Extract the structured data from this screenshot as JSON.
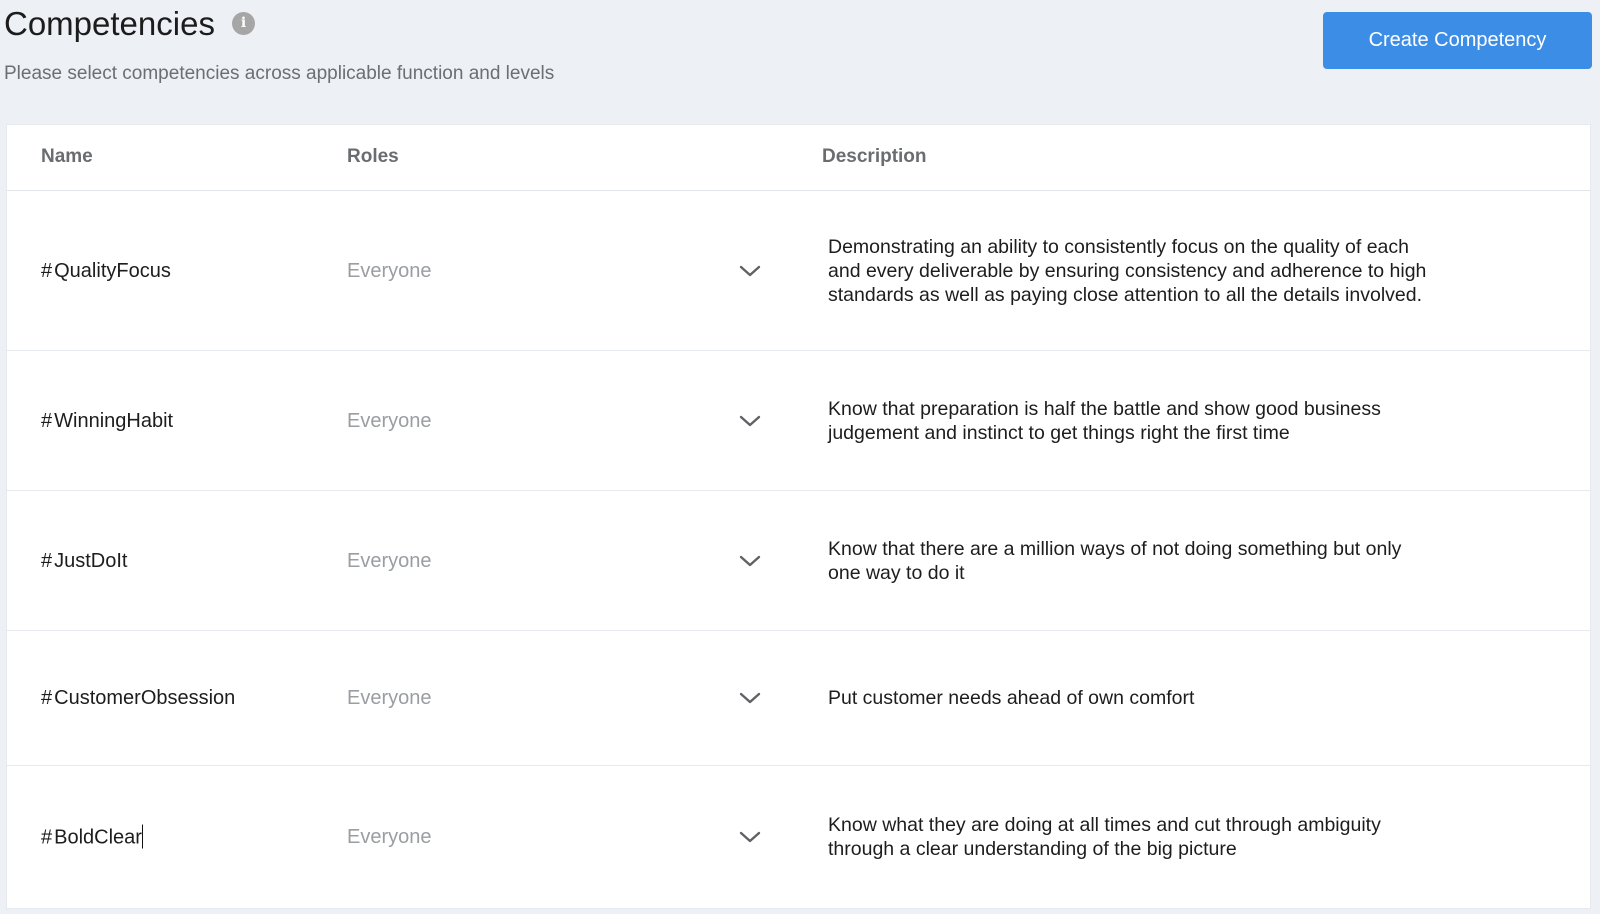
{
  "header": {
    "title": "Competencies",
    "info_icon": "info-icon",
    "subtitle": "Please select competencies across applicable function and levels",
    "create_button_label": "Create Competency",
    "accent_color": "#3b8de6"
  },
  "table": {
    "columns": {
      "name": "Name",
      "roles": "Roles",
      "description": "Description"
    },
    "rows": [
      {
        "hash": "#",
        "name": "QualityFocus",
        "roles": "Everyone",
        "description": "Demonstrating an ability to consistently focus on the quality of each and every deliverable by ensuring consistency and adherence to high standards as well as paying close attention to all the details involved."
      },
      {
        "hash": "#",
        "name": "WinningHabit",
        "roles": "Everyone",
        "description": "Know that preparation is half the battle and show good business judgement and instinct to get things right the first time"
      },
      {
        "hash": "#",
        "name": "JustDoIt",
        "roles": "Everyone",
        "description": "Know that there are a million ways of not doing something but only one way to do it"
      },
      {
        "hash": "#",
        "name": "CustomerObsession",
        "roles": "Everyone",
        "description": "Put customer needs ahead of own comfort"
      },
      {
        "hash": "#",
        "name": "BoldClear",
        "roles": "Everyone",
        "description": "Know what they are doing at all times and cut through ambiguity through a clear understanding of the big picture"
      }
    ]
  }
}
